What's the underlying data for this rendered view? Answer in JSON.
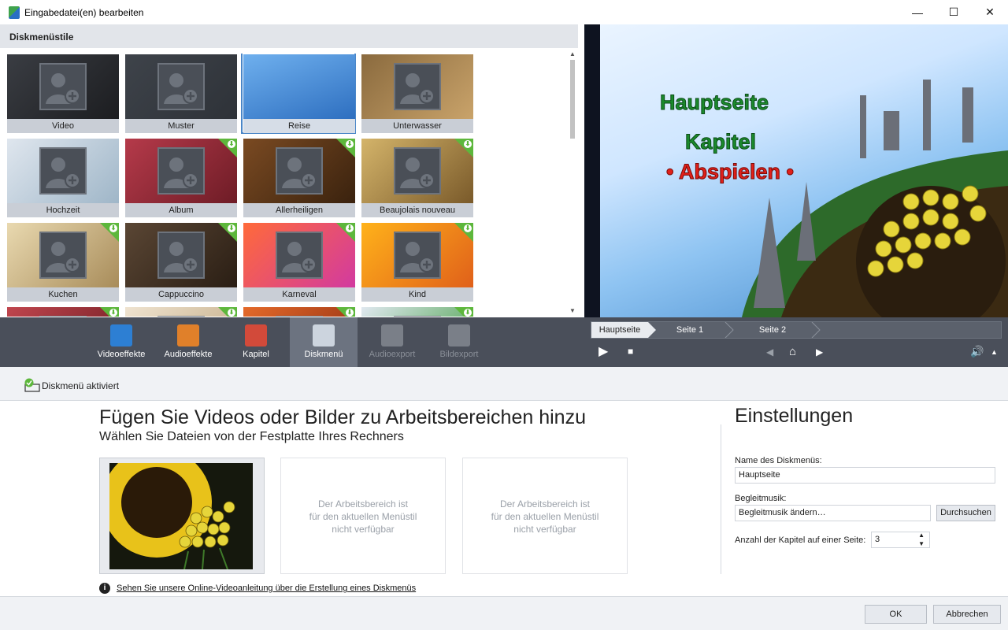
{
  "window": {
    "title": "Eingabedatei(en) bearbeiten",
    "minimize": "—",
    "maximize": "☐",
    "close": "✕"
  },
  "styles": {
    "header": "Diskmenüstile",
    "items": [
      {
        "label": "Video",
        "download": false
      },
      {
        "label": "Muster",
        "download": false
      },
      {
        "label": "Reise",
        "download": false,
        "selected": true
      },
      {
        "label": "Unterwasser",
        "download": false
      },
      {
        "label": "Hochzeit",
        "download": false
      },
      {
        "label": "Album",
        "download": true
      },
      {
        "label": "Allerheiligen",
        "download": true
      },
      {
        "label": "Beaujolais nouveau",
        "download": true
      },
      {
        "label": "Kuchen",
        "download": true
      },
      {
        "label": "Cappuccino",
        "download": true
      },
      {
        "label": "Karneval",
        "download": true
      },
      {
        "label": "Kind",
        "download": true
      }
    ]
  },
  "preview": {
    "line1": "Hauptseite",
    "line2": "Kapitel",
    "line3": "• Abspielen •"
  },
  "toolbar": {
    "items": [
      {
        "label": "Videoeffekte",
        "icon": "video-effects-icon",
        "state": "normal"
      },
      {
        "label": "Audioeffekte",
        "icon": "audio-effects-icon",
        "state": "normal"
      },
      {
        "label": "Kapitel",
        "icon": "chapter-icon",
        "state": "normal"
      },
      {
        "label": "Diskmenü",
        "icon": "disc-menu-icon",
        "state": "active"
      },
      {
        "label": "Audioexport",
        "icon": "audio-export-icon",
        "state": "disabled"
      },
      {
        "label": "Bildexport",
        "icon": "image-export-icon",
        "state": "disabled"
      }
    ]
  },
  "player": {
    "crumbs": [
      "Hauptseite",
      "Seite 1",
      "Seite 2"
    ]
  },
  "subbar": {
    "label": "Diskmenü aktiviert"
  },
  "content": {
    "title": "Fügen Sie Videos oder Bilder zu Arbeitsbereichen hinzu",
    "subtitle": "Wählen Sie Dateien von der Festplatte Ihres Rechners",
    "unavailable": "Der Arbeitsbereich ist\nfür den aktuellen Menüstil\nnicht verfügbar",
    "info_link": "Sehen Sie unsere Online-Videoanleitung über die Erstellung eines Diskmenüs"
  },
  "settings": {
    "title": "Einstellungen",
    "name_label": "Name des Diskmenüs:",
    "name_value": "Hauptseite",
    "music_label": "Begleitmusik:",
    "music_value": "Begleitmusik ändern…",
    "browse": "Durchsuchen",
    "chapters_label": "Anzahl der Kapitel auf einer Seite:",
    "chapters_value": "3"
  },
  "footer": {
    "ok": "OK",
    "cancel": "Abbrechen"
  },
  "colors": {
    "toolbar": "#4a4f5a",
    "active": "#6c7380",
    "accent": "#4a86c8",
    "download": "#5db73c"
  }
}
